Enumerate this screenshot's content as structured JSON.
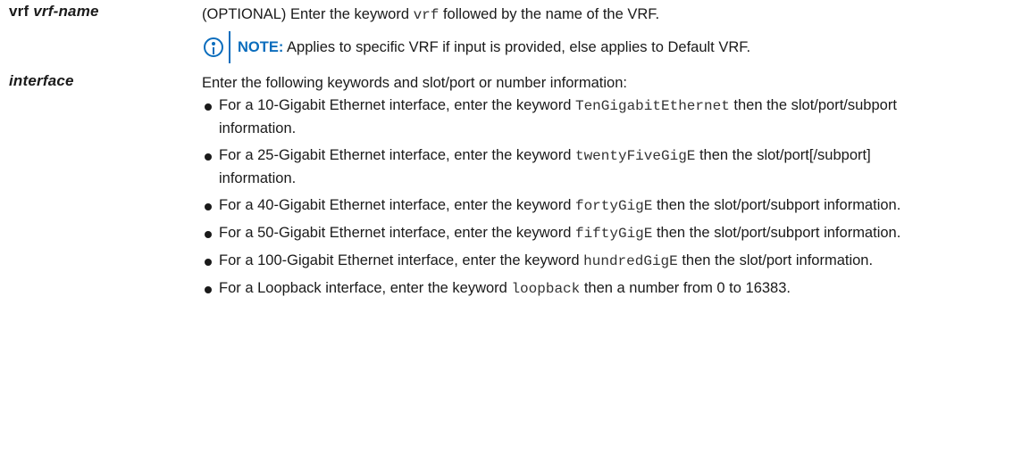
{
  "rows": [
    {
      "term_keyword": "vrf",
      "term_param": "vrf-name",
      "desc_pre": "(OPTIONAL) Enter the keyword ",
      "desc_code": "vrf",
      "desc_post": " followed by the name of the VRF.",
      "note_label": "NOTE:",
      "note_text": " Applies to specific VRF if input is provided, else applies to Default VRF."
    },
    {
      "term_param": "interface",
      "intro": "Enter the following keywords and slot/port or number information:",
      "bullets": [
        {
          "pre": "For a 10-Gigabit Ethernet interface, enter the keyword ",
          "code": "TenGigabitEthernet",
          "post": " then the slot/port/subport information."
        },
        {
          "pre": "For a 25-Gigabit Ethernet interface, enter the keyword ",
          "code": "twentyFiveGigE",
          "post": " then the slot/port[/subport] information."
        },
        {
          "pre": "For a 40-Gigabit Ethernet interface, enter the keyword ",
          "code": "fortyGigE",
          "post": " then the slot/port/subport information."
        },
        {
          "pre": "For a 50-Gigabit Ethernet interface, enter the keyword ",
          "code": "fiftyGigE",
          "post": " then the slot/port/subport information."
        },
        {
          "pre": "For a 100-Gigabit Ethernet interface, enter the keyword ",
          "code": "hundredGigE",
          "post": " then the slot/port information."
        },
        {
          "pre": "For a Loopback interface, enter the keyword ",
          "code": "loopback",
          "post": " then a number from 0 to 16383."
        }
      ]
    }
  ],
  "colors": {
    "note_accent": "#0b6dbd",
    "text": "#1a1a1a"
  },
  "icons": {
    "note": "info-icon"
  }
}
